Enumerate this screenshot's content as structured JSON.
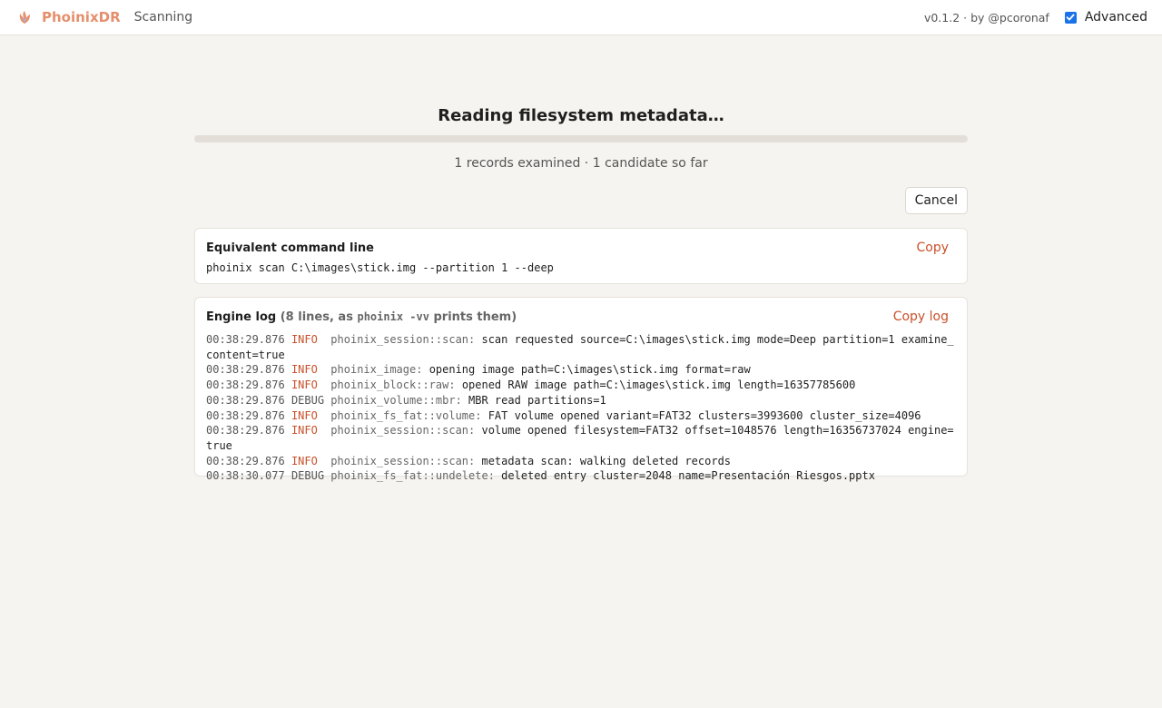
{
  "header": {
    "brand": "PhoinixDR",
    "status": "Scanning",
    "version": "v0.1.2 · by @pcoronaf",
    "advanced_label": "Advanced",
    "advanced_checked": true
  },
  "scan": {
    "heading": "Reading filesystem metadata…",
    "progress_fraction": 0,
    "summary": "1 records examined · 1 candidate so far",
    "cancel_label": "Cancel"
  },
  "command": {
    "title": "Equivalent command line",
    "copy_label": "Copy",
    "text": "phoinix scan C:\\images\\stick.img --partition 1 --deep"
  },
  "log": {
    "title": "Engine log",
    "sub_prefix": "(8 lines, as ",
    "sub_code": "phoinix -vv",
    "sub_suffix": " prints them)",
    "copy_label": "Copy log",
    "lines": [
      {
        "ts": "00:38:29.876",
        "level": "INFO",
        "target": "phoinix_session::scan:",
        "msg": "scan requested source=C:\\images\\stick.img mode=Deep partition=1 examine_content=true"
      },
      {
        "ts": "00:38:29.876",
        "level": "INFO",
        "target": "phoinix_image:",
        "msg": "opening image path=C:\\images\\stick.img format=raw"
      },
      {
        "ts": "00:38:29.876",
        "level": "INFO",
        "target": "phoinix_block::raw:",
        "msg": "opened RAW image path=C:\\images\\stick.img length=16357785600"
      },
      {
        "ts": "00:38:29.876",
        "level": "DEBUG",
        "target": "phoinix_volume::mbr:",
        "msg": "MBR read partitions=1"
      },
      {
        "ts": "00:38:29.876",
        "level": "INFO",
        "target": "phoinix_fs_fat::volume:",
        "msg": "FAT volume opened variant=FAT32 clusters=3993600 cluster_size=4096"
      },
      {
        "ts": "00:38:29.876",
        "level": "INFO",
        "target": "phoinix_session::scan:",
        "msg": "volume opened filesystem=FAT32 offset=1048576 length=16356737024 engine=true"
      },
      {
        "ts": "00:38:29.876",
        "level": "INFO",
        "target": "phoinix_session::scan:",
        "msg": "metadata scan: walking deleted records"
      },
      {
        "ts": "00:38:30.077",
        "level": "DEBUG",
        "target": "phoinix_fs_fat::undelete:",
        "msg": "deleted entry cluster=2048 name=Presentación Riesgos.pptx"
      }
    ]
  },
  "colors": {
    "accent": "#c9502a",
    "brand": "#e58f6c",
    "checkbox": "#1a73e8",
    "background": "#f6f4f0"
  },
  "icons": {
    "logo": "phoenix-logo-icon",
    "check": "checkmark-icon"
  }
}
